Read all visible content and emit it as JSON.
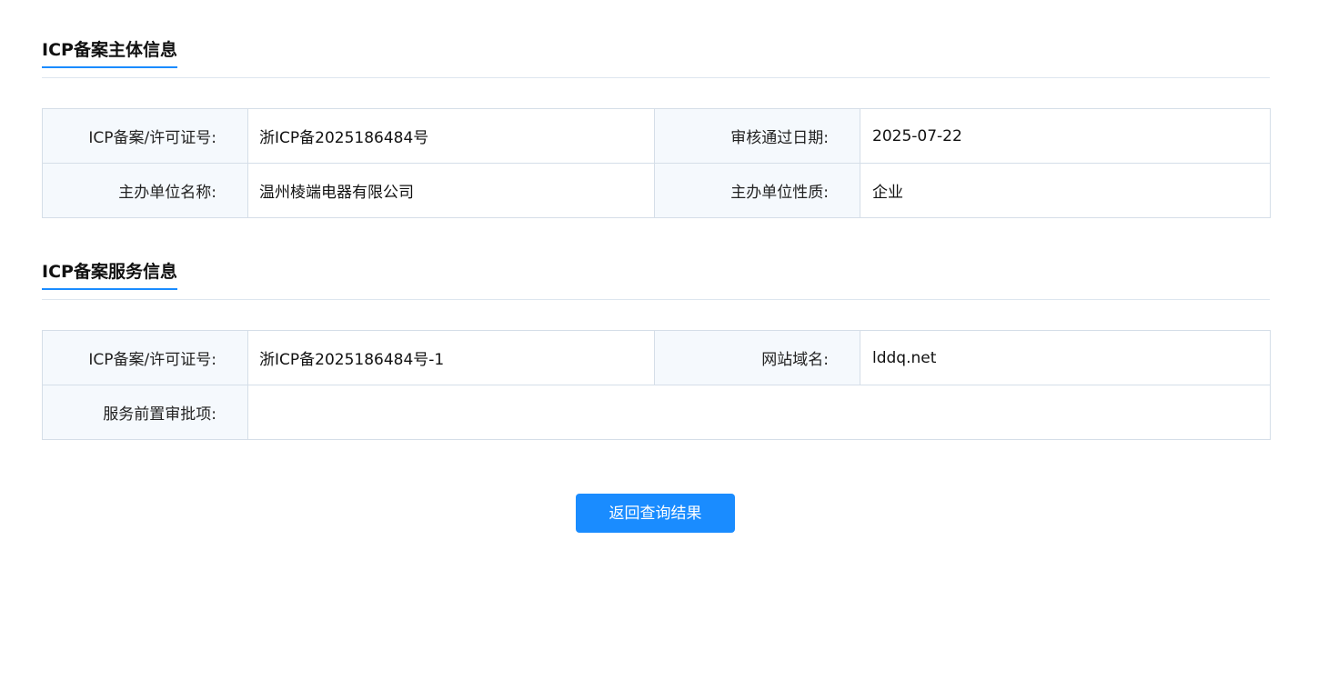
{
  "subject_section": {
    "title": "ICP备案主体信息",
    "rows": [
      {
        "label1": "ICP备案/许可证号:",
        "value1": "浙ICP备2025186484号",
        "label2": "审核通过日期:",
        "value2": "2025-07-22"
      },
      {
        "label1": "主办单位名称:",
        "value1": "温州棱端电器有限公司",
        "label2": "主办单位性质:",
        "value2": "企业"
      }
    ]
  },
  "service_section": {
    "title": "ICP备案服务信息",
    "rows": [
      {
        "label1": "ICP备案/许可证号:",
        "value1": "浙ICP备2025186484号-1",
        "label2": "网站域名:",
        "value2": "lddq.net"
      },
      {
        "label1": "服务前置审批项:",
        "value1": ""
      }
    ]
  },
  "actions": {
    "return_label": "返回查询结果"
  },
  "colors": {
    "accent": "#1a8cff",
    "label_bg": "#f5f9fd",
    "border": "#d5dee8"
  }
}
